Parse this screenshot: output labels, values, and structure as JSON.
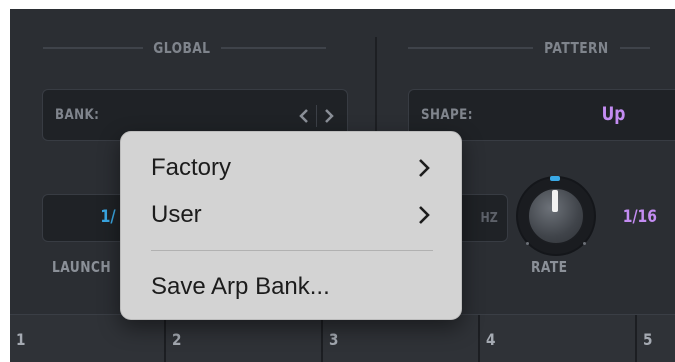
{
  "global": {
    "title": "GLOBAL",
    "bank_label": "BANK:",
    "launch_value": "1/",
    "launch_label": "LAUNCH"
  },
  "pattern": {
    "title": "PATTERN",
    "shape_label": "SHAPE:",
    "shape_value": "Up",
    "rate_hz_label": "HZ",
    "rate_value": "1/16",
    "rate_label": "RATE"
  },
  "menu": {
    "items": [
      {
        "label": "Factory",
        "has_submenu": true
      },
      {
        "label": "User",
        "has_submenu": true
      },
      {
        "label": "Save Arp Bank...",
        "has_submenu": false
      }
    ]
  },
  "sequencer": {
    "steps": [
      "1",
      "2",
      "3",
      "4",
      "5"
    ]
  },
  "colors": {
    "background": "#2b2e33",
    "accent_violet": "#c38cf2",
    "accent_blue": "#3aa9e6",
    "menu_bg": "#d3d3d3"
  },
  "icons": [
    "chevron-left-icon",
    "chevron-right-icon",
    "submenu-chevron-icon",
    "rate-knob"
  ]
}
